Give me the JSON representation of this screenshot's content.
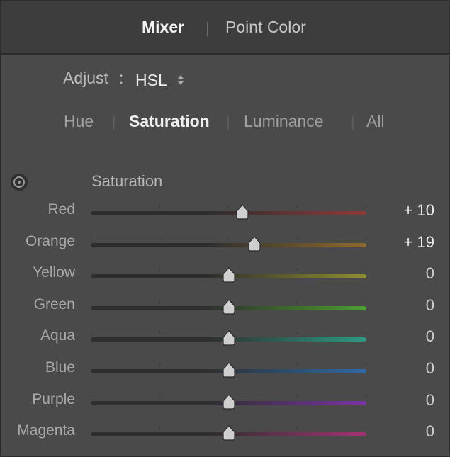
{
  "header": {
    "tabs": [
      {
        "label": "Mixer",
        "active": true
      },
      {
        "label": "Point Color",
        "active": false
      }
    ],
    "separator": "|"
  },
  "adjust": {
    "label": "Adjust",
    "colon": ":",
    "value": "HSL",
    "icon": "updown-icon"
  },
  "modes": {
    "tabs": [
      {
        "label": "Hue",
        "active": false
      },
      {
        "label": "Saturation",
        "active": true
      },
      {
        "label": "Luminance",
        "active": false
      },
      {
        "label": "All",
        "active": false
      }
    ],
    "separator": "|"
  },
  "section": {
    "title": "Saturation",
    "icon": "target-adjustment-icon"
  },
  "sliders": [
    {
      "label": "Red",
      "value": "+ 10",
      "amount": 10,
      "color": "#8e3a3a"
    },
    {
      "label": "Orange",
      "value": "+ 19",
      "amount": 19,
      "color": "#8c6a2e"
    },
    {
      "label": "Yellow",
      "value": "0",
      "amount": 0,
      "color": "#8f8f2e"
    },
    {
      "label": "Green",
      "value": "0",
      "amount": 0,
      "color": "#4e9e2e"
    },
    {
      "label": "Aqua",
      "value": "0",
      "amount": 0,
      "color": "#2d9a83"
    },
    {
      "label": "Blue",
      "value": "0",
      "amount": 0,
      "color": "#2f6aa6"
    },
    {
      "label": "Purple",
      "value": "0",
      "amount": 0,
      "color": "#7a34a6"
    },
    {
      "label": "Magenta",
      "value": "0",
      "amount": 0,
      "color": "#a03474"
    }
  ],
  "slider_range": [
    -100,
    100
  ],
  "colors": {
    "panel_bg": "#4a4a4a",
    "header_bg": "#3d3d3d",
    "track_dark": "#2e2e2e",
    "thumb": "#cfcfcf"
  }
}
